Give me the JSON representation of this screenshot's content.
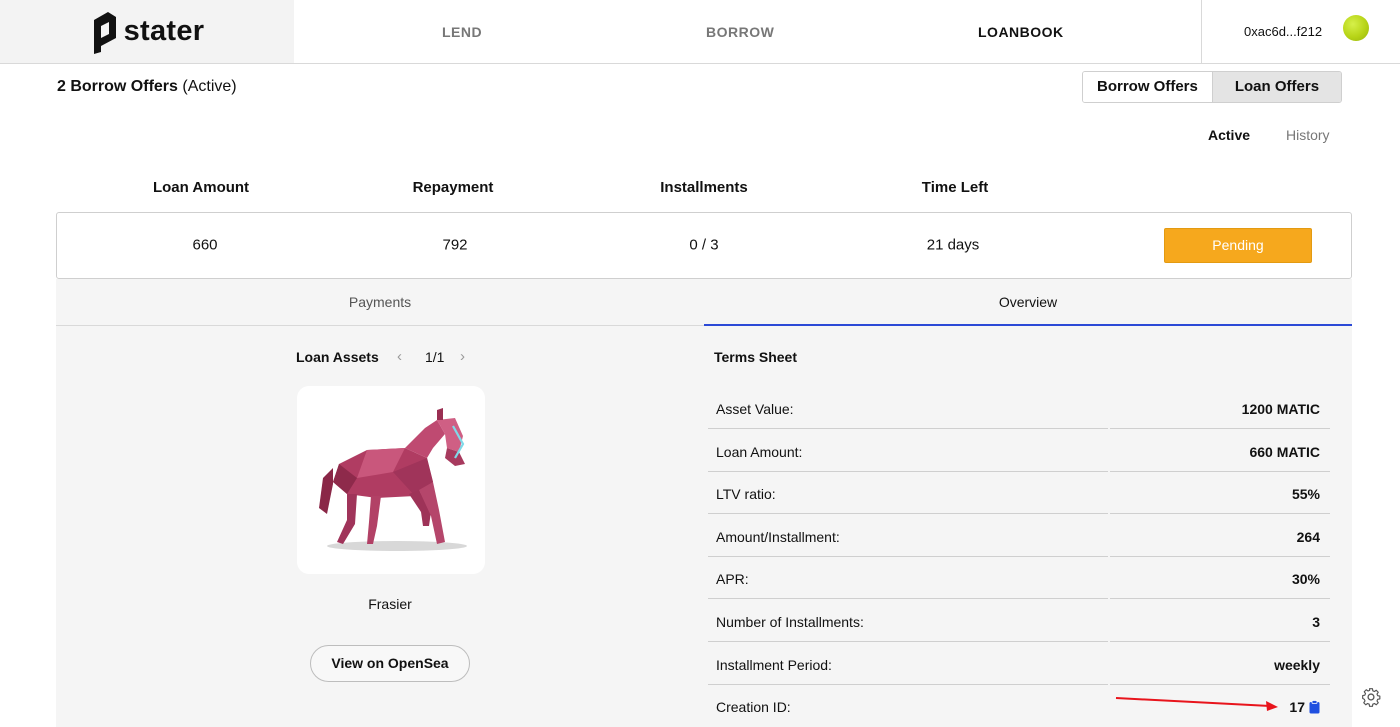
{
  "brand": {
    "name": "stater"
  },
  "nav": {
    "lend": "LEND",
    "borrow": "BORROW",
    "loanbook": "LOANBOOK",
    "active_item": "LOANBOOK"
  },
  "wallet": {
    "address": "0xac6d...f212",
    "status_color": "#b7d417"
  },
  "offers": {
    "count_label": "2 Borrow Offers",
    "status_label": "(Active)",
    "toggle": {
      "borrow_offers": "Borrow Offers",
      "loan_offers": "Loan Offers",
      "selected": "Loan Offers"
    },
    "tabs": {
      "active": "Active",
      "history": "History",
      "selected": "Active"
    }
  },
  "table": {
    "headers": [
      "Loan Amount",
      "Repayment",
      "Installments",
      "Time Left"
    ],
    "row": {
      "loan_amount": "660",
      "repayment": "792",
      "installments": "0 / 3",
      "time_left": "21 days",
      "status": "Pending",
      "status_color": "#f6a81d"
    }
  },
  "detail_tabs": {
    "payments": "Payments",
    "overview": "Overview",
    "selected": "Overview"
  },
  "assets": {
    "title": "Loan Assets",
    "page": "1/1",
    "prev_icon": "chevron-left-icon",
    "next_icon": "chevron-right-icon",
    "nft_name": "Frasier",
    "view_button": "View on OpenSea"
  },
  "terms": {
    "title": "Terms Sheet",
    "rows": [
      {
        "label": "Asset Value:",
        "value": "1200 MATIC"
      },
      {
        "label": "Loan Amount:",
        "value": "660 MATIC"
      },
      {
        "label": "LTV ratio:",
        "value": "55%"
      },
      {
        "label": "Amount/Installment:",
        "value": "264"
      },
      {
        "label": "APR:",
        "value": "30%"
      },
      {
        "label": "Number of Installments:",
        "value": "3"
      },
      {
        "label": "Installment Period:",
        "value": "weekly"
      },
      {
        "label": "Creation ID:",
        "value": "17"
      }
    ]
  },
  "accent_color": "#2b49d6"
}
